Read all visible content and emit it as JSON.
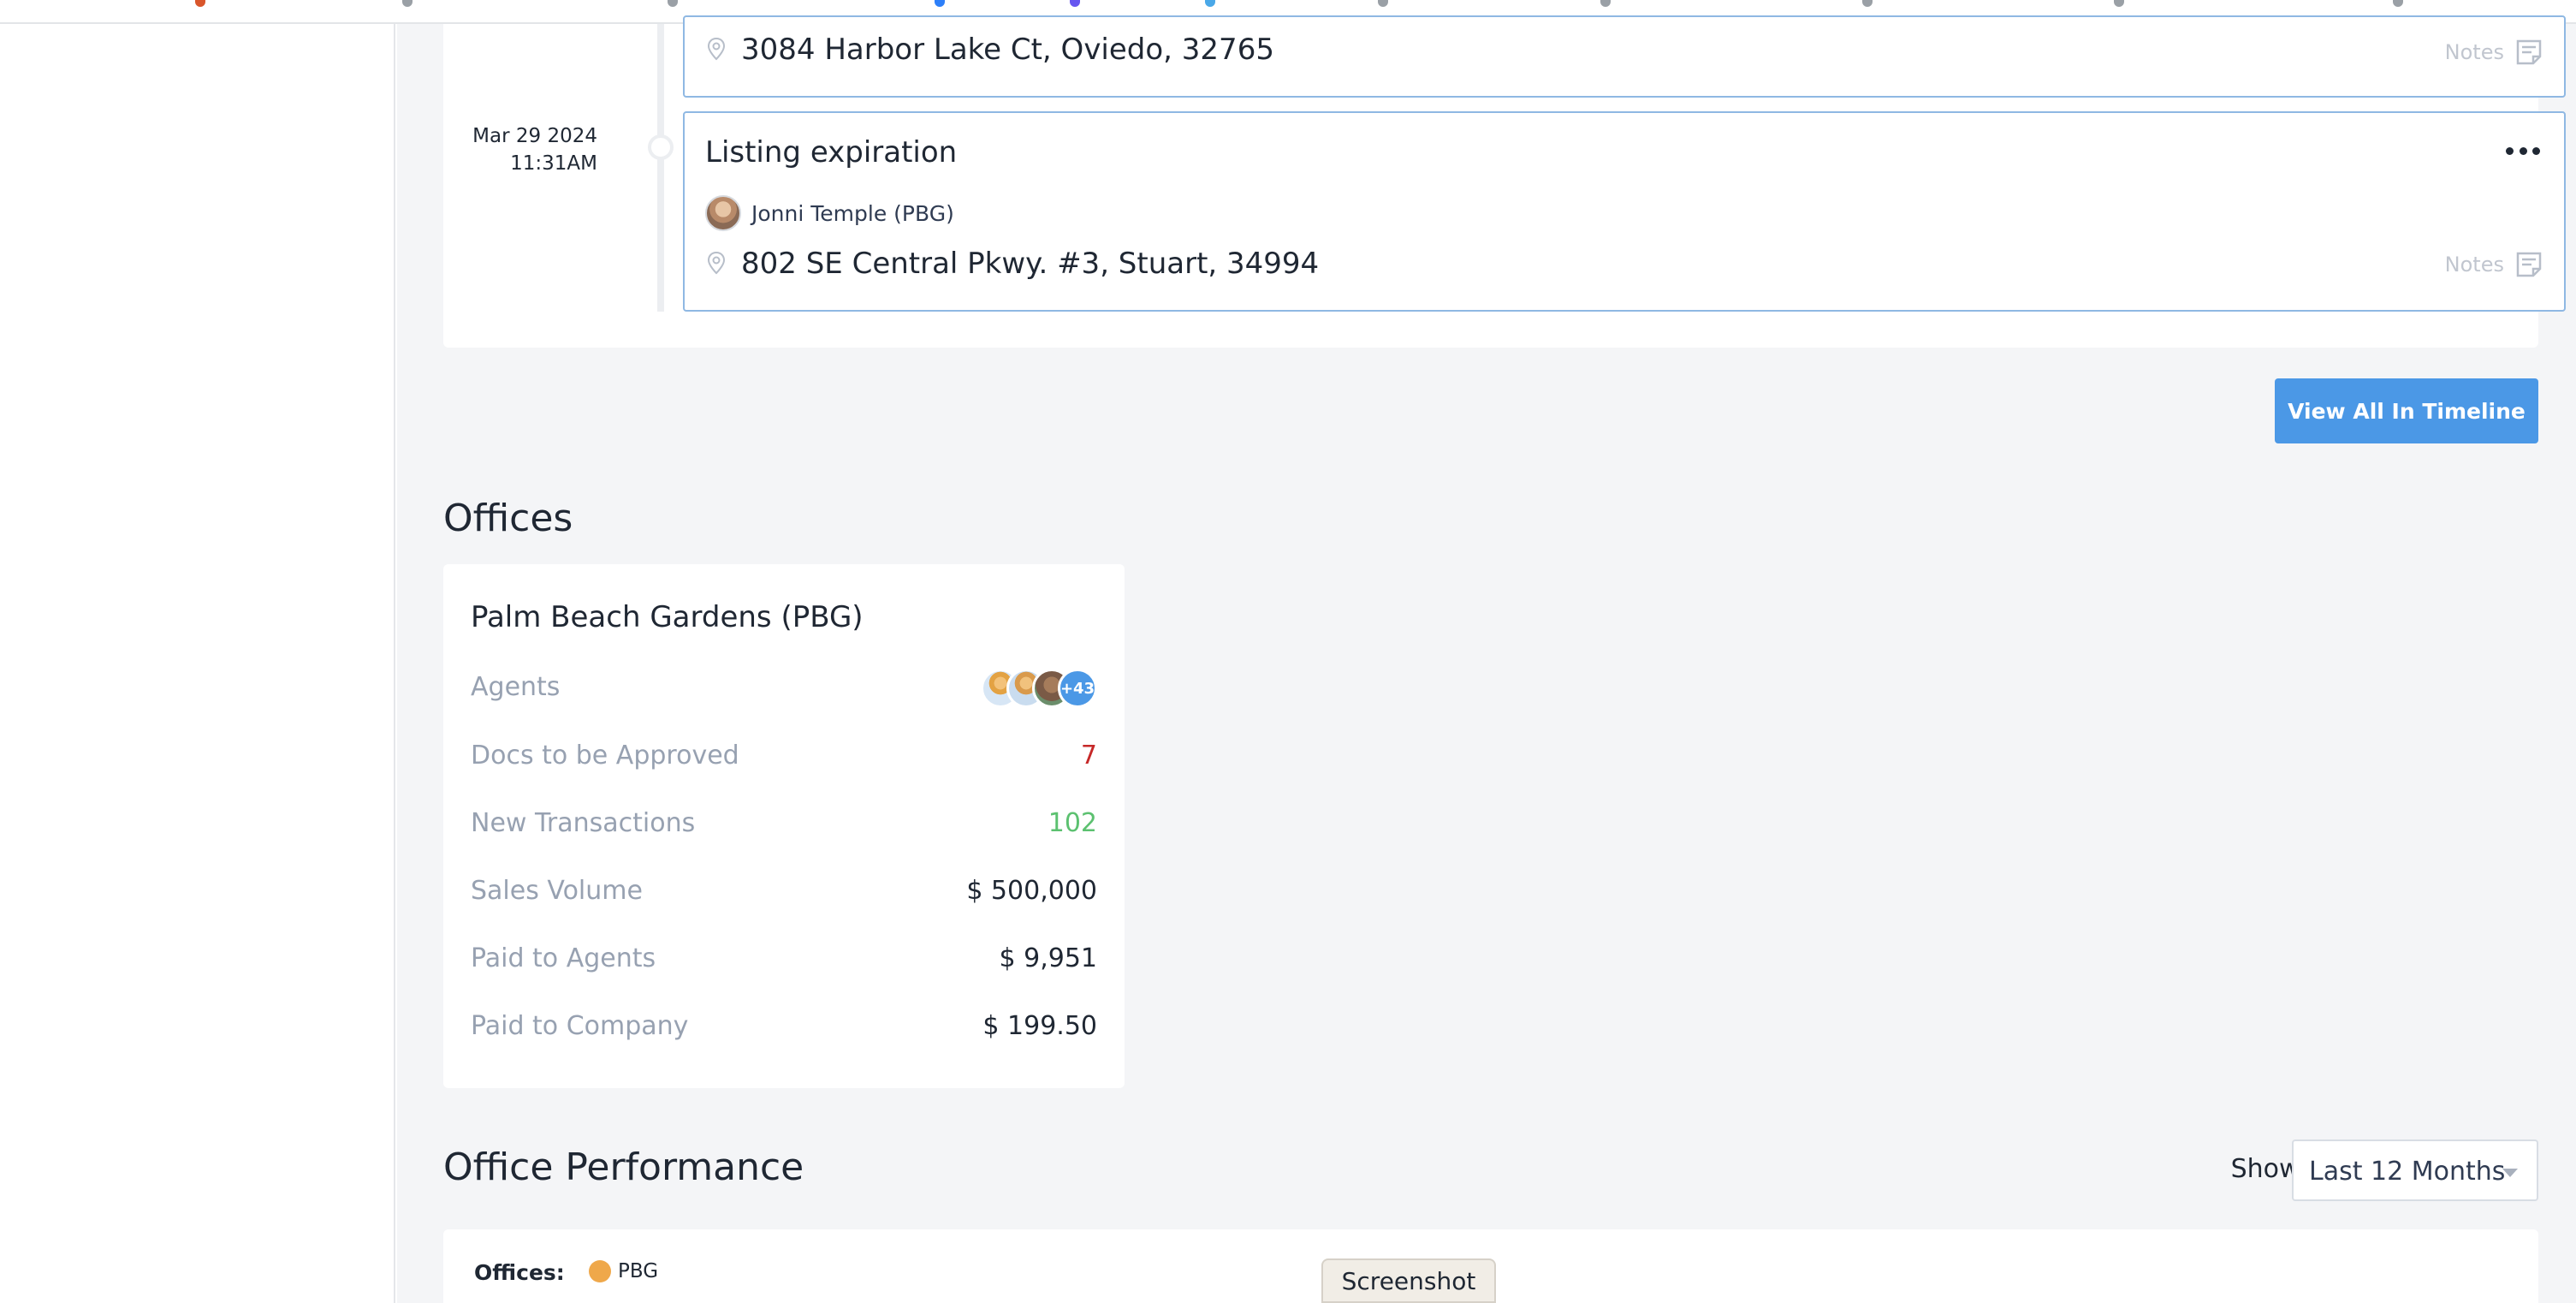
{
  "timeline": {
    "events": [
      {
        "address": "3084 Harbor Lake Ct, Oviedo, 32765",
        "notes_label": "Notes"
      },
      {
        "date": "Mar 29 2024",
        "time": "11:31AM",
        "title": "Listing expiration",
        "agent": "Jonni Temple (PBG)",
        "address": "802 SE Central Pkwy. #3, Stuart, 34994",
        "notes_label": "Notes"
      }
    ],
    "view_all_label": "View All In Timeline"
  },
  "offices": {
    "title": "Offices",
    "card": {
      "name": "Palm Beach Gardens (PBG)",
      "agents_label": "Agents",
      "agents_more": "+43",
      "stats": [
        {
          "label": "Docs to be Approved",
          "value": "7",
          "color": "#c62828"
        },
        {
          "label": "New Transactions",
          "value": "102",
          "color": "#5cc170"
        },
        {
          "label": "Sales Volume",
          "value": "$ 500,000"
        },
        {
          "label": "Paid to Agents",
          "value": "$ 9,951"
        },
        {
          "label": "Paid to Company",
          "value": "$ 199.50"
        }
      ]
    }
  },
  "performance": {
    "title": "Office Performance",
    "show_label": "Show:",
    "period": "Last 12 Months",
    "offices_label": "Offices:",
    "legend": [
      {
        "name": "PBG",
        "color": "#efa84a"
      }
    ]
  },
  "tooltip": "Screenshot",
  "colors": {
    "primary": "#4b98e6",
    "card_border": "#8fb8e3",
    "background": "#f4f5f7"
  }
}
